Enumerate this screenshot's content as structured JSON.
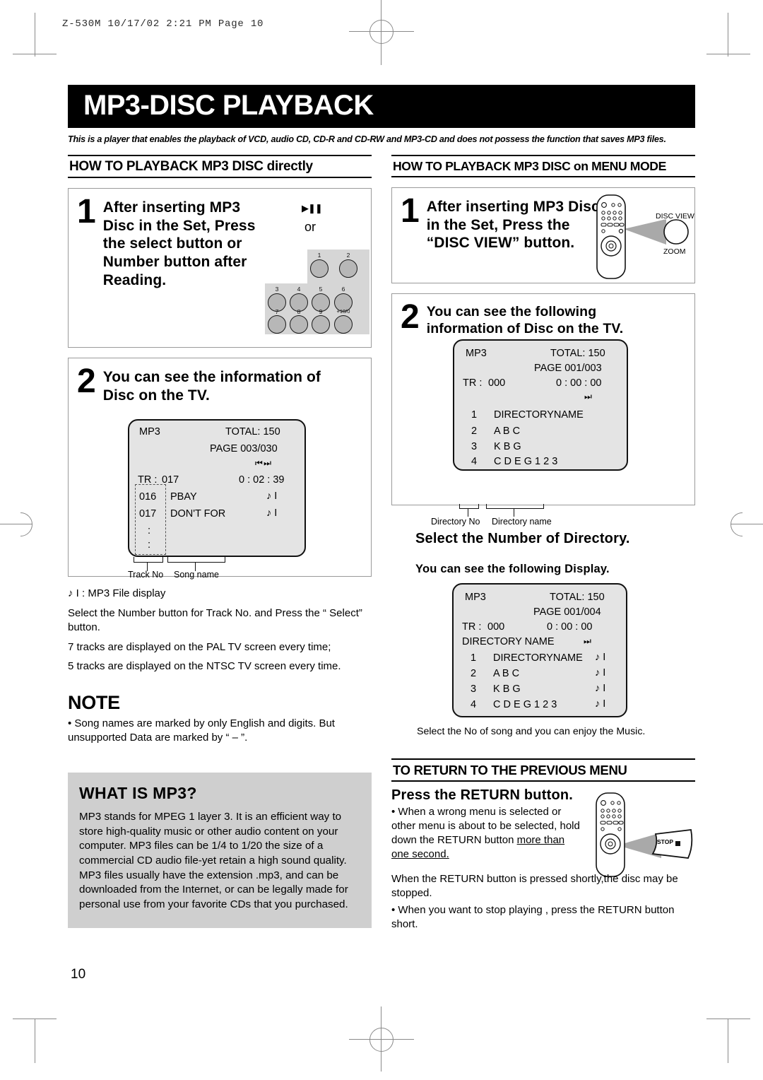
{
  "printer_slug": "Z-530M   10/17/02 2:21 PM   Page 10",
  "page_number": "10",
  "title": "MP3-DISC PLAYBACK",
  "subtitle": "This is a player that enables the playback of VCD, audio CD, CD-R and CD-RW and MP3-CD and does not possess the function that saves MP3 files.",
  "left_column": {
    "section_heading": "HOW TO PLAYBACK MP3 DISC directly",
    "step1": {
      "number": "1",
      "text": "After inserting MP3 Disc in the Set, Press the select button or Number button after Reading.",
      "play_pause_icon": "play-pause-icon",
      "or_word": "or",
      "keypad_keys": [
        "1",
        "2",
        "3",
        "4",
        "5",
        "6",
        "7",
        "8",
        "9",
        "+10/0"
      ]
    },
    "step2": {
      "number": "2",
      "text": "You can see the information of Disc on the TV.",
      "tv": {
        "label_mp3": "MP3",
        "total": "TOTAL: 150",
        "page": "PAGE  003/030",
        "nav_icons": "prev-next-icon",
        "tr_label": "TR :",
        "tr_value": "017",
        "time": "0 : 02 : 39",
        "tracks": [
          {
            "no": "016",
            "name": "PBAY",
            "icon": "music-note-icon"
          },
          {
            "no": "017",
            "name": "DON'T FOR",
            "icon": "music-note-icon"
          },
          {
            "no": ":",
            "name": "",
            "icon": ""
          },
          {
            "no": ":",
            "name": "",
            "icon": ""
          }
        ],
        "caption_track": "Track No",
        "caption_song": "Song name"
      }
    },
    "legend": "♪ I : MP3 File display",
    "note_select": "Select the Number button for Track No. and Press the “ Select” button.",
    "note_pal": "7 tracks are displayed on the PAL TV screen every time;",
    "note_ntsc": "5 tracks are displayed on the NTSC TV screen every time.",
    "note": {
      "title": "NOTE",
      "body": "• Song names are marked by only English and digits. But unsupported Data are marked by “ – ”."
    },
    "mp3_panel": {
      "heading": "WHAT IS MP3?",
      "body": "MP3 stands for MPEG 1 layer  3. It is an efficient way to store high-quality music or other audio content on your computer. MP3 files can be 1/4 to 1/20 the size of a commercial CD audio file-yet retain a high sound quality. MP3 files usually have the extension .mp3, and can be downloaded from the Internet, or can be legally made for personal use from your favorite CDs that you purchased."
    }
  },
  "right_column": {
    "section_heading": "HOW TO PLAYBACK MP3 DISC  on MENU MODE",
    "step1": {
      "number": "1",
      "text": "After inserting MP3 Disc in the Set, Press the “DISC VIEW” button.",
      "callout_top": "DISC VIEW",
      "callout_bottom": "ZOOM"
    },
    "step2": {
      "number": "2",
      "text": "You can see the following information of Disc on the TV.",
      "tv": {
        "label_mp3": "MP3",
        "total": "TOTAL: 150",
        "page": "PAGE  001/003",
        "tr_label": "TR :",
        "tr_value": "000",
        "time": "0 : 00 : 00",
        "nav_icons": "next-icon",
        "dirs": [
          {
            "no": "1",
            "name": "DIRECTORYNAME"
          },
          {
            "no": "2",
            "name": "A B C"
          },
          {
            "no": "3",
            "name": "K B G"
          },
          {
            "no": "4",
            "name": "C D E G 1 2 3"
          }
        ],
        "caption_dir_no": "Directory No",
        "caption_dir_name": "Directory name"
      }
    },
    "select_directory": "Select the Number of Directory.",
    "following_display": "You can see the following Display.",
    "tv2": {
      "label_mp3": "MP3",
      "total": "TOTAL: 150",
      "page": "PAGE  001/004",
      "tr_label": "TR :",
      "tr_value": "000",
      "time": "0 :  00 :  00",
      "dir_name_row": "DIRECTORY NAME",
      "nav_icons": "next-icon",
      "files": [
        {
          "no": "1",
          "name": "DIRECTORYNAME",
          "icon": "music-note-icon"
        },
        {
          "no": "2",
          "name": "A B C",
          "icon": "music-note-icon"
        },
        {
          "no": "3",
          "name": "K B G",
          "icon": "music-note-icon"
        },
        {
          "no": "4",
          "name": "C D E G 1 2 3",
          "icon": "music-note-icon"
        }
      ]
    },
    "enjoy_music": "Select the No of song and you can enjoy the Music.",
    "return_heading": "TO RETURN TO THE PREVIOUS MENU",
    "return_press": "Press the RETURN button.",
    "return_bullet_a": "• When a wrong menu is selected or other menu is about to be selected, hold down the RETURN button ",
    "return_bullet_a_underline": "more than one second.",
    "return_stop_label": "STOP",
    "return_text_b": "When the RETURN button is pressed shortly,the disc may be stopped.",
    "return_bullet_c": "• When you want to stop playing , press the RETURN button short."
  }
}
